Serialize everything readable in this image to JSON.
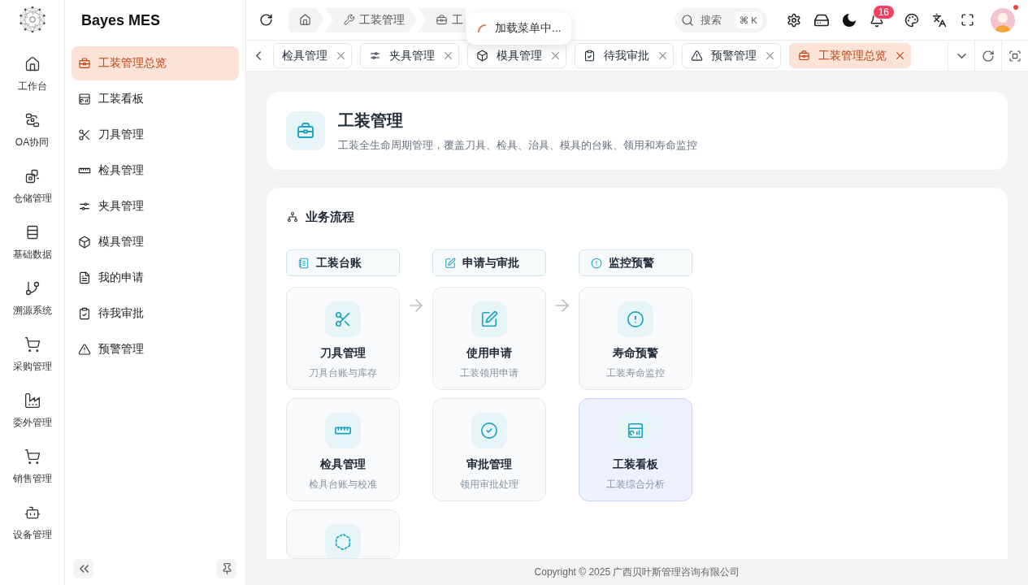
{
  "rail": {
    "items": [
      {
        "label": "工作台"
      },
      {
        "label": "OA协同"
      },
      {
        "label": "仓储管理"
      },
      {
        "label": "基础数据"
      },
      {
        "label": "溯源系统"
      },
      {
        "label": "采购管理"
      },
      {
        "label": "委外管理"
      },
      {
        "label": "销售管理"
      },
      {
        "label": "设备管理"
      }
    ]
  },
  "sidebar": {
    "title": "Bayes MES",
    "items": [
      {
        "label": "工装管理总览",
        "selected": true
      },
      {
        "label": "工装看板",
        "selected": false
      },
      {
        "label": "刀具管理",
        "selected": false
      },
      {
        "label": "检具管理",
        "selected": false
      },
      {
        "label": "夹具管理",
        "selected": false
      },
      {
        "label": "模具管理",
        "selected": false
      },
      {
        "label": "我的申请",
        "selected": false
      },
      {
        "label": "待我审批",
        "selected": false
      },
      {
        "label": "预警管理",
        "selected": false
      }
    ]
  },
  "header": {
    "breadcrumb": [
      {
        "label": "工装管理"
      },
      {
        "label": "工"
      }
    ],
    "toast": {
      "text": "加载菜单中..."
    },
    "search": {
      "label": "搜索",
      "shortcut": "⌘ K"
    },
    "notifications": {
      "badge": "16"
    },
    "avatar": {
      "unread": true
    }
  },
  "tabs": [
    {
      "label": "检具管理",
      "selected": false
    },
    {
      "label": "夹具管理",
      "selected": false
    },
    {
      "label": "模具管理",
      "selected": false
    },
    {
      "label": "待我审批",
      "selected": false
    },
    {
      "label": "预警管理",
      "selected": false
    },
    {
      "label": "工装管理总览",
      "selected": true
    }
  ],
  "overview": {
    "title": "工装管理",
    "description": "工装全生命周期管理，覆盖刀具、检具、治具、模具的台账、领用和寿命监控"
  },
  "flow": {
    "title": "业务流程",
    "columns": [
      {
        "label": "工装台账",
        "cards": [
          {
            "title": "刀具管理",
            "subtitle": "刀具台账与库存",
            "highlighted": false
          },
          {
            "title": "检具管理",
            "subtitle": "检具台账与校准",
            "highlighted": false
          },
          {
            "highlighted": false
          }
        ]
      },
      {
        "label": "申请与审批",
        "cards": [
          {
            "title": "使用申请",
            "subtitle": "工装领用申请",
            "highlighted": false
          },
          {
            "title": "审批管理",
            "subtitle": "领用审批处理",
            "highlighted": false
          }
        ]
      },
      {
        "label": "监控预警",
        "cards": [
          {
            "title": "寿命预警",
            "subtitle": "工装寿命监控",
            "highlighted": false
          },
          {
            "title": "工装看板",
            "subtitle": "工装综合分析",
            "highlighted": true
          }
        ]
      }
    ]
  },
  "footer": {
    "text": "Copyright © 2025 广西贝叶斯管理咨询有限公司"
  }
}
